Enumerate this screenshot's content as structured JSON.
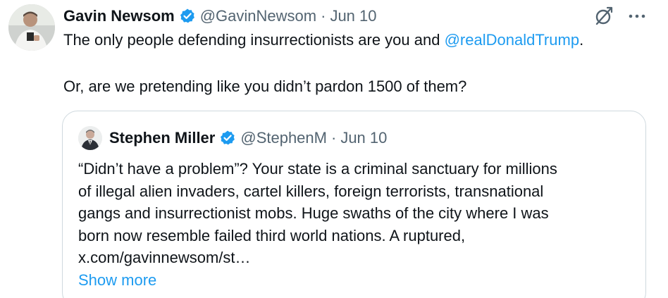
{
  "tweet": {
    "author_name": "Gavin Newsom",
    "handle": "@GavinNewsom",
    "separator": "·",
    "date": "Jun 10",
    "text_part1": "The only people defending insurrectionists are you and ",
    "mention": "@realDonaldTrump",
    "text_part1_end": ".",
    "text_part2": "Or, are we pretending like you didn’t pardon 1500 of them?",
    "icons": [
      "grok-icon",
      "more-icon"
    ]
  },
  "quote": {
    "author_name": "Stephen Miller",
    "handle": "@StephenM",
    "separator": "·",
    "date": "Jun 10",
    "lines": [
      "“Didn’t have a problem”? Your state is a criminal sanctuary for millions",
      "of illegal alien invaders, cartel killers, foreign terrorists, transnational",
      "gangs and insurrectionist mobs. Huge swaths of the city where I was",
      "born now resemble failed third world nations. A ruptured,",
      "x.com/gavinnewsom/st…"
    ],
    "show_more": "Show more"
  },
  "colors": {
    "accent": "#1d9bf0",
    "muted": "#536471",
    "text": "#0f1419",
    "border": "#cfd9de"
  }
}
